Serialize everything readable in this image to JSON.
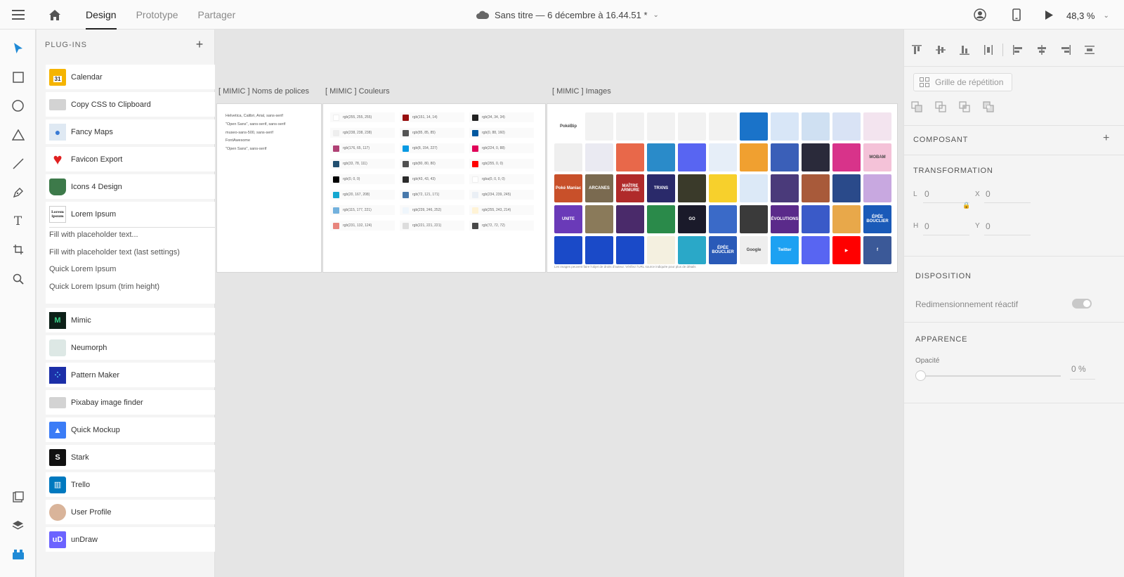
{
  "topbar": {
    "tabs": [
      {
        "label": "Design"
      },
      {
        "label": "Prototype"
      },
      {
        "label": "Partager"
      }
    ],
    "doc_title": "Sans titre — 6 décembre à 16.44.51 *",
    "zoom": "48,3 %"
  },
  "plugins": {
    "header": "PLUG-INS",
    "items": [
      {
        "label": "Calendar",
        "icon": "calendar-icon",
        "color": "#f5b400",
        "glyph": "31"
      },
      {
        "label": "Copy CSS to Clipboard",
        "icon": "clipboard-icon",
        "color": "#cfcfcf",
        "glyph": ""
      },
      {
        "label": "Fancy Maps",
        "icon": "map-pin-icon",
        "color": "#6aa0d8",
        "glyph": "●"
      },
      {
        "label": "Favicon Export",
        "icon": "heart-icon",
        "color": "#e02020",
        "glyph": "♥"
      },
      {
        "label": "Icons 4 Design",
        "icon": "coffee-cup-icon",
        "color": "#3d7a4a",
        "glyph": "☕"
      },
      {
        "label": "Lorem Ipsum",
        "icon": "lorem-ipsum-icon",
        "color": "#ffffff",
        "glyph": "Lorem ipsum"
      },
      {
        "label": "Mimic",
        "icon": "mimic-icon",
        "color": "#0d2018",
        "glyph": "M"
      },
      {
        "label": "Neumorph",
        "icon": "neumorph-icon",
        "color": "#dde8e5",
        "glyph": ""
      },
      {
        "label": "Pattern Maker",
        "icon": "pattern-icon",
        "color": "#1c2fa8",
        "glyph": "⁘"
      },
      {
        "label": "Pixabay image finder",
        "icon": "image-folder-icon",
        "color": "#cfcfcf",
        "glyph": ""
      },
      {
        "label": "Quick Mockup",
        "icon": "mountains-icon",
        "color": "#3b7cf6",
        "glyph": "▲"
      },
      {
        "label": "Stark",
        "icon": "stark-icon",
        "color": "#111111",
        "glyph": "S"
      },
      {
        "label": "Trello",
        "icon": "trello-icon",
        "color": "#0079bf",
        "glyph": "▥"
      },
      {
        "label": "User Profile",
        "icon": "user-avatar-icon",
        "color": "#d9b49a",
        "glyph": ""
      },
      {
        "label": "unDraw",
        "icon": "undraw-icon",
        "color": "#6c63ff",
        "glyph": "uD"
      }
    ],
    "lorem_actions": [
      "Fill with placeholder text...",
      "Fill with placeholder text (last settings)",
      "Quick Lorem Ipsum",
      "Quick Lorem Ipsum (trim height)"
    ]
  },
  "canvas": {
    "artboards": [
      {
        "label": "[ MIMIC ] Noms de polices"
      },
      {
        "label": "[ MIMIC ] Couleurs"
      },
      {
        "label": "[ MIMIC ] Images"
      }
    ],
    "fonts": [
      "Helvetica, Calibri, Arial, sans-serif",
      "\"Open Sans\", sans-serif, sans-serif",
      "museo-sans-500, sans-serif",
      "FontAwesome",
      "\"Open Sans\", sans-serif"
    ],
    "colors": [
      [
        {
          "text": "rgb(255, 255, 255)",
          "hex": "#ffffff"
        },
        {
          "text": "rgb(151, 14, 14)",
          "hex": "#970e0e"
        },
        {
          "text": "rgb(34, 34, 34)",
          "hex": "#222222"
        }
      ],
      [
        {
          "text": "rgb(238, 238, 238)",
          "hex": "#eeeeee"
        },
        {
          "text": "rgb(85, 85, 85)",
          "hex": "#555555"
        },
        {
          "text": "rgb(0, 88, 160)",
          "hex": "#0058a0"
        }
      ],
      [
        {
          "text": "rgb(176, 65, 117)",
          "hex": "#b04175"
        },
        {
          "text": "rgb(8, 154, 227)",
          "hex": "#089ae3"
        },
        {
          "text": "rgb(224, 0, 88)",
          "hex": "#e00058"
        }
      ],
      [
        {
          "text": "rgb(33, 78, 111)",
          "hex": "#214e6f"
        },
        {
          "text": "rgb(80, 80, 80)",
          "hex": "#505050"
        },
        {
          "text": "rgb(255, 0, 0)",
          "hex": "#ff0000"
        }
      ],
      [
        {
          "text": "rgb(0, 0, 0)",
          "hex": "#000000"
        },
        {
          "text": "rgb(43, 43, 43)",
          "hex": "#2b2b2b"
        },
        {
          "text": "rgba(0, 0, 0, 0)",
          "hex": "#ffffff"
        }
      ],
      [
        {
          "text": "rgb(20, 167, 208)",
          "hex": "#14a7d0"
        },
        {
          "text": "rgb(72, 121, 171)",
          "hex": "#4879ab"
        },
        {
          "text": "rgb(234, 239, 245)",
          "hex": "#eaeff5"
        }
      ],
      [
        {
          "text": "rgb(115, 177, 221)",
          "hex": "#73b1dd"
        },
        {
          "text": "rgb(239, 246, 252)",
          "hex": "#eff6fc"
        },
        {
          "text": "rgb(255, 243, 214)",
          "hex": "#fff3d6"
        }
      ],
      [
        {
          "text": "rgb(231, 132, 124)",
          "hex": "#e7847c"
        },
        {
          "text": "rgb(221, 221, 221)",
          "hex": "#dddddd"
        },
        {
          "text": "rgb(72, 72, 72)",
          "hex": "#484848"
        }
      ]
    ],
    "images": [
      {
        "color": "#ffffff",
        "text": "PokéBip"
      },
      {
        "color": "#f2f2f2",
        "text": ""
      },
      {
        "color": "#f2f2f2",
        "text": ""
      },
      {
        "color": "#f2f2f2",
        "text": ""
      },
      {
        "color": "#f2f2f2",
        "text": ""
      },
      {
        "color": "#f2f2f2",
        "text": ""
      },
      {
        "color": "#1a73c9",
        "text": ""
      },
      {
        "color": "#d8e6f7",
        "text": ""
      },
      {
        "color": "#cfe0f2",
        "text": ""
      },
      {
        "color": "#d9e3f5",
        "text": ""
      },
      {
        "color": "#f3e4ef",
        "text": ""
      },
      {
        "color": "#efefef",
        "text": ""
      },
      {
        "color": "#eaeaf2",
        "text": ""
      },
      {
        "color": "#e8684a",
        "text": ""
      },
      {
        "color": "#2a8bc9",
        "text": ""
      },
      {
        "color": "#5865f2",
        "text": ""
      },
      {
        "color": "#e6eef8",
        "text": ""
      },
      {
        "color": "#f0a030",
        "text": ""
      },
      {
        "color": "#3a5fb8",
        "text": ""
      },
      {
        "color": "#2a2a3a",
        "text": ""
      },
      {
        "color": "#d8338a",
        "text": ""
      },
      {
        "color": "#f4c2d8",
        "text": "MOBAM"
      },
      {
        "color": "#c8502a",
        "text": "Poké Maniac"
      },
      {
        "color": "#7a6a50",
        "text": "ARCANES"
      },
      {
        "color": "#b02a2a",
        "text": "MAÎTRE ARMURE"
      },
      {
        "color": "#2a2a6a",
        "text": "TRXNS"
      },
      {
        "color": "#3a3a2a",
        "text": ""
      },
      {
        "color": "#f7d02c",
        "text": ""
      },
      {
        "color": "#dce9f7",
        "text": ""
      },
      {
        "color": "#4a3a7a",
        "text": ""
      },
      {
        "color": "#a85a3a",
        "text": ""
      },
      {
        "color": "#2a4a8a",
        "text": ""
      },
      {
        "color": "#c8a8e0",
        "text": ""
      },
      {
        "color": "#6a3ab8",
        "text": "UNITE"
      },
      {
        "color": "#8a7a5a",
        "text": ""
      },
      {
        "color": "#4a2a6a",
        "text": ""
      },
      {
        "color": "#2a8a4a",
        "text": ""
      },
      {
        "color": "#1a1a2a",
        "text": "GO"
      },
      {
        "color": "#3a6ac8",
        "text": ""
      },
      {
        "color": "#3a3a3a",
        "text": ""
      },
      {
        "color": "#5a2a8a",
        "text": "ÉVOLUTIONS"
      },
      {
        "color": "#3a5ac8",
        "text": ""
      },
      {
        "color": "#e8a84a",
        "text": ""
      },
      {
        "color": "#1a5ab8",
        "text": "ÉPÉE BOUCLIER"
      },
      {
        "color": "#1a4ac8",
        "text": ""
      },
      {
        "color": "#1a4ac8",
        "text": ""
      },
      {
        "color": "#1a4ac8",
        "text": ""
      },
      {
        "color": "#f4f0e0",
        "text": ""
      },
      {
        "color": "#2aa8c8",
        "text": ""
      },
      {
        "color": "#2a5ab8",
        "text": "ÉPÉE BOUCLIER"
      },
      {
        "color": "#eeeeee",
        "text": "Google"
      },
      {
        "color": "#1da1f2",
        "text": "Twitter"
      },
      {
        "color": "#5865f2",
        "text": ""
      },
      {
        "color": "#ff0000",
        "text": "▶"
      },
      {
        "color": "#3b5998",
        "text": "f"
      }
    ],
    "image_caption": "Les images peuvent faire l'objet de droits d'auteur. Vérifiez l'URL source indiquée pour plus de détails"
  },
  "right_panel": {
    "repeat_grid": "Grille de répétition",
    "component": "COMPOSANT",
    "transform": "TRANSFORMATION",
    "fields": {
      "L": "0",
      "X": "0",
      "H": "0",
      "Y": "0"
    },
    "layout": "DISPOSITION",
    "responsive": "Redimensionnement réactif",
    "appearance": "APPARENCE",
    "opacity_label": "Opacité",
    "opacity_value": "0 %",
    "opacity_fraction": 0
  }
}
